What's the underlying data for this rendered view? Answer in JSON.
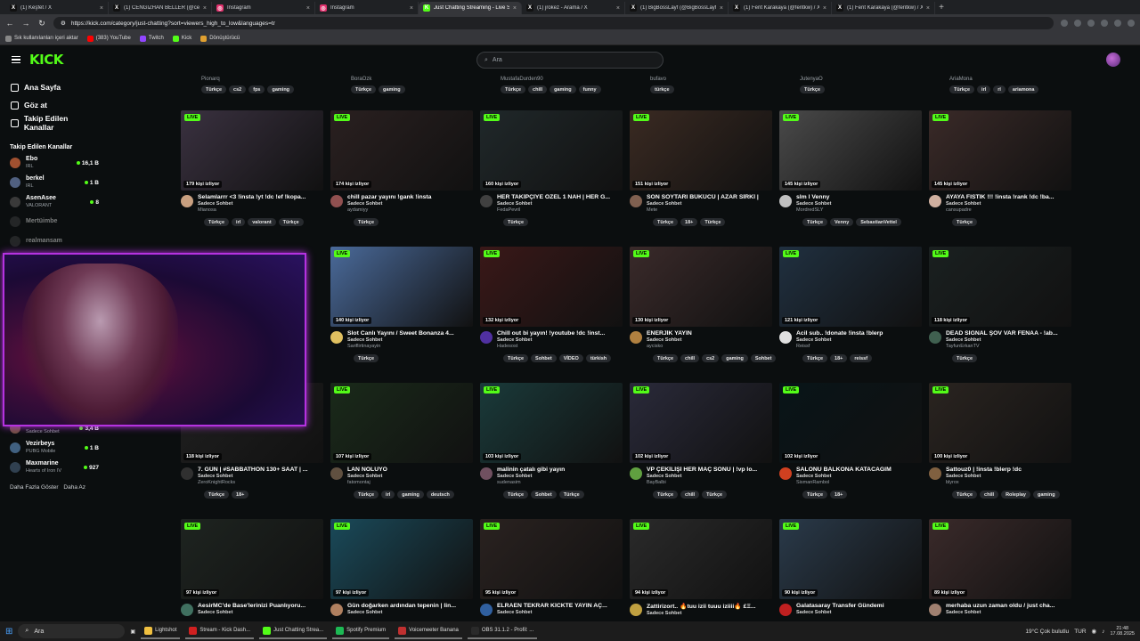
{
  "browser": {
    "tabs": [
      {
        "title": "(1) Keşfet / X",
        "icon": "x-icon",
        "color": "#000000"
      },
      {
        "title": "(1) CENGİZHAN BELLER (@cengo",
        "icon": "x-icon",
        "color": "#000000"
      },
      {
        "title": "Instagram",
        "icon": "instagram-icon",
        "color": "#e1306c"
      },
      {
        "title": "Instagram",
        "icon": "instagram-icon",
        "color": "#e1306c"
      },
      {
        "title": "Just Chatting Streaming - Live St",
        "icon": "kick-icon",
        "color": "#53fc18"
      },
      {
        "title": "(1) jrokez - Arama / X",
        "icon": "x-icon",
        "color": "#000000"
      },
      {
        "title": "(1) BigBossLayf (@BigBossLayf) / X",
        "icon": "x-icon",
        "color": "#000000"
      },
      {
        "title": "(1) Ferit Karakaya (@feritkw) / X",
        "icon": "x-icon",
        "color": "#000000"
      },
      {
        "title": "(1) Ferit Karakaya (@feritkw) / X",
        "icon": "x-icon",
        "color": "#000000"
      }
    ],
    "url": "https://kick.com/category/just-chatting?sort=viewers_high_to_low&languages=tr",
    "bookmarks": [
      "Sık kullanılanları içeri aktar",
      "(383) YouTube",
      "Twitch",
      "Kick",
      "Dönüştürücü"
    ]
  },
  "header": {
    "logo": "KICK",
    "search_placeholder": "Ara"
  },
  "sidebar": {
    "nav": [
      {
        "label": "Ana Sayfa",
        "icon": "home-icon"
      },
      {
        "label": "Göz at",
        "icon": "browse-icon"
      },
      {
        "label": "Takip Edilen Kanallar",
        "icon": "heart-icon"
      }
    ],
    "followed_title": "Takip Edilen Kanallar",
    "followed": [
      {
        "name": "Ebo",
        "sub": "IRL",
        "viewers": "16,1 B",
        "color": "#a05030",
        "online": true
      },
      {
        "name": "berkel",
        "sub": "IRL",
        "viewers": "1 B",
        "color": "#506080",
        "online": true
      },
      {
        "name": "AsenAsee",
        "sub": "VALORANT",
        "viewers": "8",
        "color": "#3a3a3a",
        "online": true
      },
      {
        "name": "Mertüimbe",
        "sub": "",
        "viewers": "",
        "color": "#444",
        "online": false
      },
      {
        "name": "realmansam",
        "sub": "",
        "viewers": "",
        "color": "#444",
        "online": false
      }
    ],
    "followed_bottom": [
      {
        "name": "ErenAktan",
        "sub": "Sadece Sohbet",
        "viewers": "3,4 B",
        "color": "#705040",
        "online": true
      },
      {
        "name": "Vezirbeys",
        "sub": "PUBG Mobile",
        "viewers": "1 B",
        "color": "#406080",
        "online": true
      },
      {
        "name": "Maxmarine",
        "sub": "Hearts of Iron IV",
        "viewers": "927",
        "color": "#304050",
        "online": true
      }
    ],
    "show_more": "Daha Fazla Göster",
    "show_less": "Daha Az"
  },
  "top_row": [
    {
      "channel": "Pionarq",
      "tags": [
        "Türkçe",
        "cs2",
        "fps",
        "gaming"
      ]
    },
    {
      "channel": "BoraOzk",
      "tags": [
        "Türkçe",
        "gaming"
      ]
    },
    {
      "channel": "MustafaDurden90",
      "tags": [
        "Türkçe",
        "chill",
        "gaming",
        "funny"
      ]
    },
    {
      "channel": "bufavo",
      "tags": [
        "türkçe"
      ]
    },
    {
      "channel": "JutenyaO",
      "tags": [
        "Türkçe"
      ]
    },
    {
      "channel": "AriaMona",
      "tags": [
        "Türkçe",
        "irl",
        "rl",
        "ariamona"
      ]
    }
  ],
  "streams": [
    {
      "title": "Selamlarrr <3 !insta !yt !dc !ef !kopa...",
      "category": "Sadece Sohbet",
      "channel": "Mianosa",
      "viewers": "179 kişi izliyor",
      "tags": [
        "Türkçe",
        "irl",
        "valorant",
        "Türkçe"
      ],
      "bg": "#3a3140",
      "av": "#c9a080"
    },
    {
      "title": "chill pazar yayını !gank !insta",
      "category": "Sadece Sohbet",
      "channel": "aydamiyy",
      "viewers": "174 kişi izliyor",
      "tags": [
        "Türkçe"
      ],
      "bg": "#2a2020",
      "av": "#905050"
    },
    {
      "title": "HER TAKİPÇİYE ÖZEL 1 NAH | HER G...",
      "category": "Sadece Sohbet",
      "channel": "FedaPevril",
      "viewers": "160 kişi izliyor",
      "tags": [
        "Türkçe"
      ],
      "bg": "#20282a",
      "av": "#404040"
    },
    {
      "title": "SON SOYTARI BÜKÜCÜ | AZAR SİRKİ |",
      "category": "Sadece Sohbet",
      "channel": "Mete",
      "viewers": "151 kişi izliyor",
      "tags": [
        "Türkçe",
        "18+",
        "Türkçe"
      ],
      "bg": "#3a2a22",
      "av": "#806050"
    },
    {
      "title": "slm l Venny",
      "category": "Sadece Sohbet",
      "channel": "MordredSLY",
      "viewers": "145 kişi izliyor",
      "tags": [
        "Türkçe",
        "Venny",
        "SebastianVettel"
      ],
      "bg": "#4a4a4a",
      "av": "#c0c0c0"
    },
    {
      "title": "AYAYA FISTIK !!! !insta !rank !dc !ba...",
      "category": "Sadece Sohbet",
      "channel": "cansupadre",
      "viewers": "145 kişi izliyor",
      "tags": [
        "Türkçe"
      ],
      "bg": "#3a2a28",
      "av": "#d0b0a0"
    },
    {
      "title": "",
      "category": "",
      "channel": "",
      "viewers": "",
      "tags": [],
      "bg": "#222",
      "av": "#333"
    },
    {
      "title": "Slot Canlı Yayını / Sweet Bonanza 4...",
      "category": "Sadece Sohbet",
      "channel": "Sariflirtinayayin",
      "viewers": "140 kişi izliyor",
      "tags": [
        "Türkçe"
      ],
      "bg": "#4a6a9a",
      "av": "#e0c060"
    },
    {
      "title": "Chill out bi yayın! !youtube !dc !inst...",
      "category": "Sadece Sohbet",
      "channel": "Hadesost",
      "viewers": "132 kişi izliyor",
      "tags": [
        "Türkçe",
        "Sohbet",
        "VİDEO",
        "türkish"
      ],
      "bg": "#3a1818",
      "av": "#5030a0"
    },
    {
      "title": "ENERJİK YAYIN",
      "category": "Sadece Sohbet",
      "channel": "aycisko",
      "viewers": "130 kişi izliyor",
      "tags": [
        "Türkçe",
        "chill",
        "cs2",
        "gaming",
        "Sohbet"
      ],
      "bg": "#3a2a2a",
      "av": "#b08040"
    },
    {
      "title": "Acil sub.. !donate !insta !blerp",
      "category": "Sadece Sohbet",
      "channel": "Reissf",
      "viewers": "121 kişi izliyor",
      "tags": [
        "Türkçe",
        "18+",
        "reissf"
      ],
      "bg": "#203040",
      "av": "#e0e0e0"
    },
    {
      "title": "DEAD SİGNAL ŞOV VAR FENAA - !ab...",
      "category": "Sadece Sohbet",
      "channel": "TayfunErkanTV",
      "viewers": "118 kişi izliyor",
      "tags": [
        "Türkçe"
      ],
      "bg": "#1a2020",
      "av": "#406050"
    },
    {
      "title": "7. GÜN | #SABBATHON 130+ SAAT | ...",
      "category": "Sadece Sohbet",
      "channel": "ZeroKnightRocks",
      "viewers": "118 kişi izliyor",
      "tags": [
        "Türkçe",
        "18+"
      ],
      "bg": "#202020",
      "av": "#303030"
    },
    {
      "title": "LAN NOLUYO",
      "category": "Sadece Sohbet",
      "channel": "fatomontaj",
      "viewers": "107 kişi izliyor",
      "tags": [
        "Türkçe",
        "irl",
        "gaming",
        "deutsch"
      ],
      "bg": "#1a2a1a",
      "av": "#605040"
    },
    {
      "title": "malinin çatalı gibi yayın",
      "category": "Sadece Sohbet",
      "channel": "sudenasim",
      "viewers": "103 kişi izliyor",
      "tags": [
        "Türkçe",
        "Sohbet",
        "Türkçe"
      ],
      "bg": "#1a3a3a",
      "av": "#705060"
    },
    {
      "title": "VP ÇEKİLİŞİ HER MAÇ SONU | !vp lo...",
      "category": "Sadece Sohbet",
      "channel": "BayBalbi",
      "viewers": "102 kişi izliyor",
      "tags": [
        "Türkçe",
        "chill",
        "Türkçe"
      ],
      "bg": "#2a2a3a",
      "av": "#60a040"
    },
    {
      "title": "SALONU BALKONA KATACAĞIM",
      "category": "Sadece Sohbet",
      "channel": "SismanRambol",
      "viewers": "102 kişi izliyor",
      "tags": [
        "Türkçe",
        "18+"
      ],
      "bg": "#081418",
      "av": "#d04020"
    },
    {
      "title": "Sattouz0 | !insta !blerp !dc",
      "category": "Sadece Sohbet",
      "channel": "blyrox",
      "viewers": "100 kişi izliyor",
      "tags": [
        "Türkçe",
        "chill",
        "Roleplay",
        "gaming"
      ],
      "bg": "#2a2420",
      "av": "#806040"
    },
    {
      "title": "AesirMC'de Base'lerinizi Puanlıyoru...",
      "category": "Sadece Sohbet",
      "channel": "",
      "viewers": "97 kişi izliyor",
      "tags": [],
      "bg": "#1e2420",
      "av": "#407060"
    },
    {
      "title": "Gün doğarken ardından tepenin | lin...",
      "category": "Sadece Sohbet",
      "channel": "",
      "viewers": "97 kişi izliyor",
      "tags": [],
      "bg": "#1a4a5a",
      "av": "#b08060"
    },
    {
      "title": "ELRAEN TEKRAR KİCKTE YAYIN AÇ...",
      "category": "Sadece Sohbet",
      "channel": "",
      "viewers": "95 kişi izliyor",
      "tags": [],
      "bg": "#2a2220",
      "av": "#3060a0"
    },
    {
      "title": "Zattirizort.. 🔥tuu izii tuuu iziiii🔥 £Ξ...",
      "category": "Sadece Sohbet",
      "channel": "",
      "viewers": "94 kişi izliyor",
      "tags": [],
      "bg": "#2a2a2a",
      "av": "#c0a040"
    },
    {
      "title": "Galatasaray Transfer Gündemi",
      "category": "Sadece Sohbet",
      "channel": "",
      "viewers": "90 kişi izliyor",
      "tags": [],
      "bg": "#2a3a4a",
      "av": "#c02020"
    },
    {
      "title": "merhaba uzun zaman oldu / just cha...",
      "category": "Sadece Sohbet",
      "channel": "",
      "viewers": "89 kişi izliyor",
      "tags": [],
      "bg": "#3a2a2a",
      "av": "#a08070"
    }
  ],
  "live_label": "LIVE",
  "taskbar": {
    "search": "Ara",
    "apps": [
      "Lightshot",
      "Stream - Kick Dash...",
      "Just Chatting Strea...",
      "Spotify Premium",
      "Voicemeeter Banana",
      "OBS 31.1.2 - Profil: ..."
    ],
    "weather": "19°C Çok bulutlu",
    "lang": "TUR",
    "time": "21:48",
    "date": "17.08.2025"
  }
}
